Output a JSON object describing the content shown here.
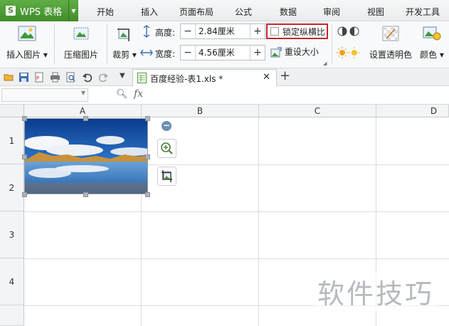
{
  "app": {
    "title": "WPS 表格",
    "logo": "S"
  },
  "menu_tabs": [
    "开始",
    "插入",
    "页面布局",
    "公式",
    "数据",
    "审阅",
    "视图",
    "开发工具"
  ],
  "ribbon": {
    "insert_picture": "插入图片",
    "compress_picture": "压缩图片",
    "crop": "裁剪",
    "height_label": "高度:",
    "height_value": "2.84厘米",
    "width_label": "宽度:",
    "width_value": "4.56厘米",
    "lock_aspect": "锁定纵横比",
    "reset_size": "重设大小",
    "set_transparent": "设置透明色",
    "color": "颜色"
  },
  "document_tab": {
    "title": "百度经验-表1.xls *"
  },
  "formula_bar": {
    "fx": "fx"
  },
  "grid": {
    "columns": [
      "A",
      "B",
      "C",
      "D"
    ],
    "rows": [
      "1",
      "2",
      "3",
      "4"
    ]
  },
  "watermark": "软件技巧",
  "colors": {
    "app_green": "#4a9a35",
    "highlight_red": "#c0282e",
    "accent_blue": "#3a6fb0"
  }
}
